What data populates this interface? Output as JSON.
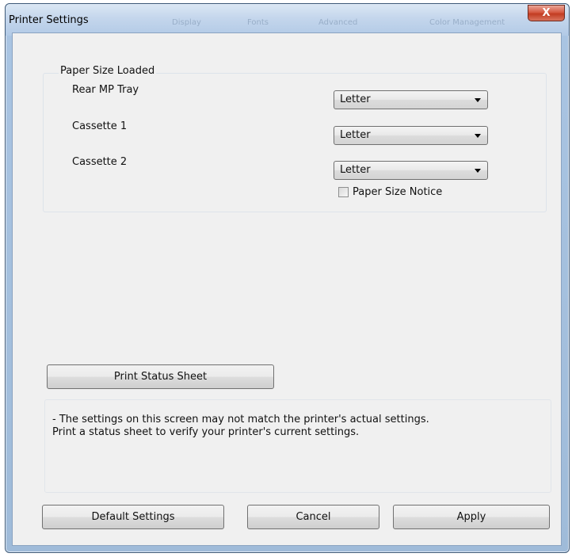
{
  "window": {
    "title": "Printer Settings",
    "ghost_tabs": [
      "Display",
      "Fonts",
      "Advanced",
      "Color Management"
    ],
    "close_glyph": "X"
  },
  "paper_group": {
    "legend": "Paper Size Loaded",
    "rows": [
      {
        "label": "Rear MP Tray",
        "value": "Letter"
      },
      {
        "label": "Cassette 1",
        "value": "Letter"
      },
      {
        "label": "Cassette 2",
        "value": "Letter"
      }
    ],
    "notice_checkbox": {
      "label": "Paper Size Notice",
      "checked": false
    }
  },
  "buttons": {
    "print_status": "Print Status Sheet",
    "default_settings": "Default Settings",
    "cancel": "Cancel",
    "apply": "Apply"
  },
  "notice": {
    "line1": "- The settings on this screen may not match the printer's actual settings.",
    "line2": "Print a status sheet to verify your printer's current settings."
  },
  "colors": {
    "frame_blue": "#a9c4e2",
    "close_red": "#c23c22",
    "dialog_bg": "#f0f0f0"
  }
}
